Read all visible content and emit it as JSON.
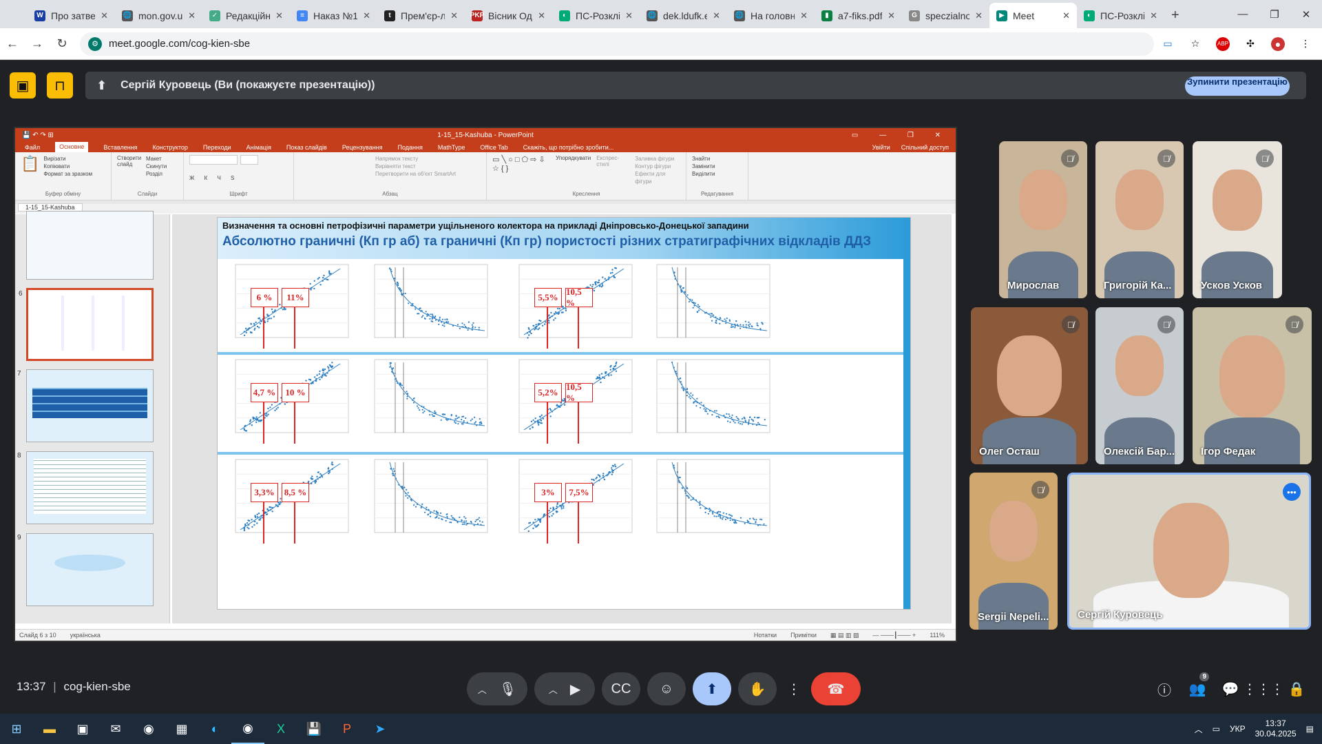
{
  "browser": {
    "tabs": [
      {
        "title": "Про затве",
        "favicon": "W",
        "color": "#1a3fa3"
      },
      {
        "title": "mon.gov.u",
        "favicon": "🌐",
        "color": "#555"
      },
      {
        "title": "Редакційн",
        "favicon": "✓",
        "color": "#4a8"
      },
      {
        "title": "Наказ №1",
        "favicon": "≡",
        "color": "#4285f4"
      },
      {
        "title": "Прем'єр-л",
        "favicon": "t",
        "color": "#222"
      },
      {
        "title": "Вісник Од",
        "favicon": "PKP",
        "color": "#b22"
      },
      {
        "title": "ПС-Розклі",
        "favicon": "◐",
        "color": "#0a7"
      },
      {
        "title": "dek.ldufk.e",
        "favicon": "🌐",
        "color": "#555"
      },
      {
        "title": "На головн",
        "favicon": "🌐",
        "color": "#555"
      },
      {
        "title": "a7-fiks.pdf",
        "favicon": "▮",
        "color": "#0b8043"
      },
      {
        "title": "speczialno",
        "favicon": "G",
        "color": "#888"
      },
      {
        "title": "Meet",
        "favicon": "▶",
        "color": "#00897b"
      },
      {
        "title": "ПС-Розклі",
        "favicon": "◐",
        "color": "#0a7"
      }
    ],
    "active_tab_index": 11,
    "url": "meet.google.com/cog-kien-sbe"
  },
  "meet": {
    "presenting_text": "Сергій Куровець (Ви (покажуєте презентацію))",
    "stop_button": "Зупинити презентацію",
    "clock": "13:37",
    "separator": "|",
    "meeting_code": "cog-kien-sbe",
    "participants_count": "9",
    "participants": [
      {
        "name": "Мирослав",
        "muted": true
      },
      {
        "name": "Григорій Ка...",
        "muted": true
      },
      {
        "name": "Усков Усков",
        "muted": true
      },
      {
        "name": "Олег Осташ",
        "muted": true
      },
      {
        "name": "Олексій Бар...",
        "muted": true
      },
      {
        "name": "Ігор Федак",
        "muted": true
      },
      {
        "name": "Sergii Nepeli...",
        "muted": true
      },
      {
        "name": "Сергій Куровець",
        "muted": false
      }
    ]
  },
  "powerpoint": {
    "window_title": "1-15_15-Kashuba - PowerPoint",
    "menu": [
      "Файл",
      "Основне",
      "Вставлення",
      "Конструктор",
      "Переходи",
      "Анімація",
      "Показ слайдів",
      "Рецензування",
      "Подання",
      "MathType",
      "Office Tab",
      "Скажіть, що потрібно зробити..."
    ],
    "menu_right": [
      "Увійти",
      "Спільний доступ"
    ],
    "ribbon_groups": [
      "Буфер обміну",
      "Слайди",
      "Шрифт",
      "Абзац",
      "Креслення",
      "Редагування"
    ],
    "ribbon_items": {
      "paste": "Вставити",
      "cut": "Вирізати",
      "copy": "Копіювати",
      "format": "Формат за зразком",
      "new_slide": "Створити слайд",
      "layout": "Макет",
      "reset": "Скинути",
      "section": "Розділ",
      "arrange": "Упорядкувати",
      "styles": "Експрес-стилі",
      "fill": "Заливка фігури",
      "outline": "Контур фігури",
      "effects": "Ефекти для фігури",
      "find": "Знайти",
      "replace": "Замінити",
      "select": "Виділити",
      "text_dir": "Напрямок тексту",
      "align_text": "Вирівняти текст",
      "smartart": "Перетворити на об'єкт SmartArt"
    },
    "doc_tab": "1-15_15-Kashuba",
    "slide_numbers": [
      "6",
      "7",
      "8",
      "9"
    ],
    "status": {
      "slide": "Слайд 6 з 10",
      "lang": "українська",
      "notes": "Нотатки",
      "comments": "Примітки",
      "zoom": "111%"
    },
    "slide": {
      "line1": "Визначення та основні петрофізичні параметри ущільненого колектора на прикладі Дніпровсько-Донецької западини",
      "line2": "Абсолютно граничні (Кп гр аб) та граничні (Кп гр) пористості різних стратиграфічних відкладів ДДЗ",
      "tags": [
        [
          "6 %",
          "11%"
        ],
        [
          "5,5%",
          "10,5 %"
        ],
        [
          "4,7 %",
          "10 %"
        ],
        [
          "5,2%",
          "10,5 %"
        ],
        [
          "3,3%",
          "8,5 %"
        ],
        [
          "3%",
          "7,5%"
        ]
      ]
    }
  },
  "taskbar": {
    "lang": "УКР",
    "time": "13:37",
    "date": "30.04.2025"
  },
  "colors": {
    "meet_bg": "#202124",
    "accent": "#8ab4f8",
    "end_call": "#ea4335",
    "ppt": "#c43e1c",
    "tag_red": "#dd2222",
    "scatter": "#2e7fc1"
  }
}
